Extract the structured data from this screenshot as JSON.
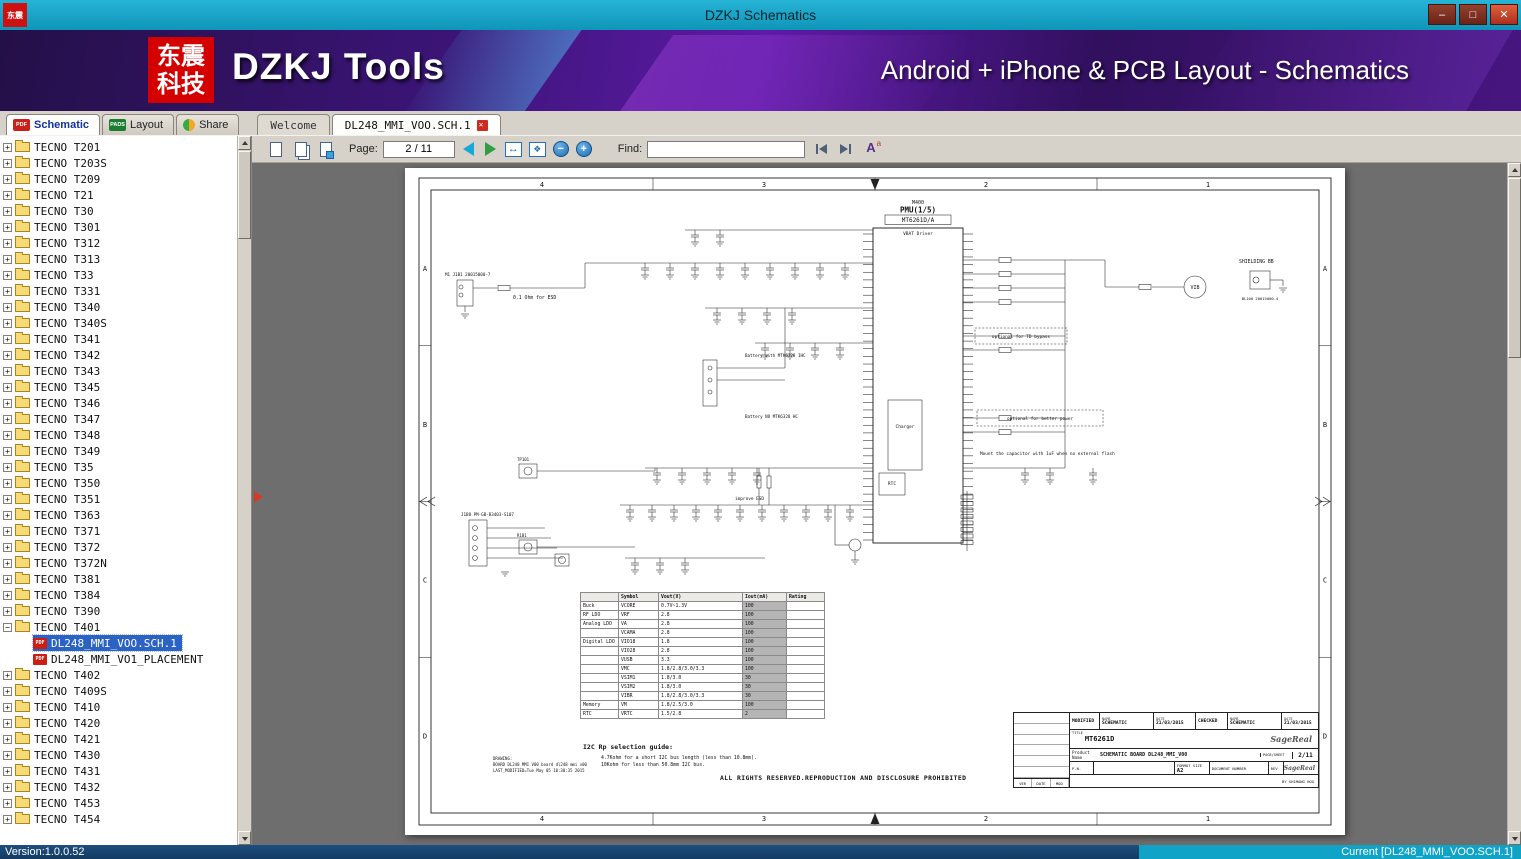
{
  "window": {
    "title": "DZKJ Schematics",
    "minimize": "–",
    "maximize": "□",
    "close": "✕"
  },
  "banner": {
    "logo_line1": "东震",
    "logo_line2": "科技",
    "app_name": "DZKJ Tools",
    "tagline": "Android + iPhone & PCB Layout - Schematics"
  },
  "tabs": {
    "mode": [
      {
        "label": "Schematic",
        "badge": "PDF"
      },
      {
        "label": "Layout",
        "badge": "PADS"
      },
      {
        "label": "Share",
        "badge": ""
      }
    ],
    "docs": [
      {
        "label": "Welcome",
        "active": false
      },
      {
        "label": "DL248_MMI_VOO.SCH.1",
        "active": true
      }
    ]
  },
  "toolbar": {
    "page_label": "Page:",
    "page_value": "2 / 11",
    "find_label": "Find:"
  },
  "sidebar": {
    "pdf_badge": "PDF",
    "expand_plus": "+",
    "expand_minus": "−",
    "folders_before": [
      "TECNO T201",
      "TECNO T203S",
      "TECNO T209",
      "TECNO T21",
      "TECNO T30",
      "TECNO T301",
      "TECNO T312",
      "TECNO T313",
      "TECNO T33",
      "TECNO T331",
      "TECNO T340",
      "TECNO T340S",
      "TECNO T341",
      "TECNO T342",
      "TECNO T343",
      "TECNO T345",
      "TECNO T346",
      "TECNO T347",
      "TECNO T348",
      "TECNO T349",
      "TECNO T35",
      "TECNO T350",
      "TECNO T351",
      "TECNO T363",
      "TECNO T371",
      "TECNO T372",
      "TECNO T372N",
      "TECNO T381",
      "TECNO T384",
      "TECNO T390"
    ],
    "expanded_folder": "TECNO T401",
    "children": [
      {
        "label": "DL248_MMI_VOO.SCH.1",
        "selected": true
      },
      {
        "label": "DL248_MMI_VO1_PLACEMENT",
        "selected": false
      }
    ],
    "folders_after": [
      "TECNO T402",
      "TECNO T409S",
      "TECNO T410",
      "TECNO T420",
      "TECNO T421",
      "TECNO T430",
      "TECNO T431",
      "TECNO T432",
      "TECNO T453",
      "TECNO T454"
    ]
  },
  "statusbar": {
    "version": "Version:1.0.0.52",
    "current": "Current [DL248_MMI_VOO.SCH.1]"
  },
  "schematic": {
    "grid_cols": [
      "4",
      "3",
      "2",
      "1"
    ],
    "grid_rows": [
      "A",
      "B",
      "C",
      "D"
    ],
    "labels": {
      "pmu_ref": "M400",
      "pmu_title": "PMU(1/5)",
      "chip_name": "MT6261D/A",
      "vbat": "VBAT Driver",
      "charger": "Charger",
      "rtc": "RTC",
      "m1_ref": "M1 J1B1 20015000-7",
      "esd_note": "0.1 Ohm for ESD",
      "shielding": "SHIELDING BB",
      "vib": "VIB",
      "bl100": "BL100 20015000-4",
      "battery1": "Battery with MTK6328 IHC",
      "battery2": "Battery NO MTK6328 HC",
      "opt_td": "optional for TD bypass",
      "opt_power": "optional for better power",
      "flash_note": "Mount the capacitor with 1uF when no external flash",
      "improve_esd": "improve ESD",
      "j1b8": "J1B8 PM-GB-B3403-S107",
      "tp101": "TP101",
      "r1b1": "R1B1",
      "i2c_title": "I2C Rp selection guide:",
      "i2c_line1": "4.7Kohm for a short I2C bus length (less than 10.8mm).",
      "i2c_line2": "10Kohm for less than 50.8mm I2C bus.",
      "drawing1": "DRAWING:",
      "drawing2": "BOARD DL248 MMI V00  board dl248 mmi v00",
      "drawing3": "LAST_MODIFIED=Tue May 05 10:30:35 2015",
      "rights": "ALL RIGHTS RESERVED.REPRODUCTION AND DISCLOSURE PROHIBITED"
    },
    "power_table": {
      "headers": [
        "",
        "Symbol",
        "Vout(V)",
        "Iout(mA)",
        "Rating"
      ],
      "rows": [
        [
          "Buck",
          "VCORE",
          "0.7V~1.3V",
          "100",
          ""
        ],
        [
          "RF LDO",
          "VRF",
          "2.8",
          "100",
          ""
        ],
        [
          "Analog LDO",
          "VA",
          "2.8",
          "100",
          ""
        ],
        [
          "",
          "VCAMA",
          "2.8",
          "100",
          ""
        ],
        [
          "Digital LDO",
          "VIO18",
          "1.8",
          "100",
          ""
        ],
        [
          "",
          "VIO28",
          "2.8",
          "100",
          ""
        ],
        [
          "",
          "VUSB",
          "3.3",
          "100",
          ""
        ],
        [
          "",
          "VMC",
          "1.8/2.8/3.0/3.3",
          "100",
          ""
        ],
        [
          "",
          "VSIM1",
          "1.8/3.0",
          "30",
          ""
        ],
        [
          "",
          "VSIM2",
          "1.8/3.0",
          "30",
          ""
        ],
        [
          "",
          "VIBR",
          "1.8/2.8/3.0/3.3",
          "30",
          ""
        ],
        [
          "Memory",
          "VM",
          "1.8/2.5/3.0",
          "100",
          ""
        ],
        [
          "RTC",
          "VRTC",
          "1.5/2.8",
          "2",
          ""
        ]
      ]
    },
    "titleblock": {
      "modified": "MODIFIED",
      "name_label": "NAME",
      "date_label": "DATE",
      "checked_label": "CHECKED",
      "name1": "SCHEMATIC",
      "date1": "21/03/2015",
      "name2": "SCHEMATIC",
      "date2": "21/03/2015",
      "title_label": "TITLE",
      "title": "MT6261D",
      "product_label": "Product Name",
      "product": "SCHEMATIC BOARD DL248_MMI_V00",
      "page_label": "PAGE/SHEET",
      "sheet": "2/11",
      "pn_label": "P.N.",
      "format_label": "FORMAT SIZE",
      "size": "A2",
      "doc_label": "DOCUMENT NUMBER",
      "rev_label": "REV",
      "brand": "SageReal",
      "by": "BY SHIMANG HOG",
      "ver": "VER",
      "date_col": "DATE",
      "mod": "MOD"
    }
  }
}
